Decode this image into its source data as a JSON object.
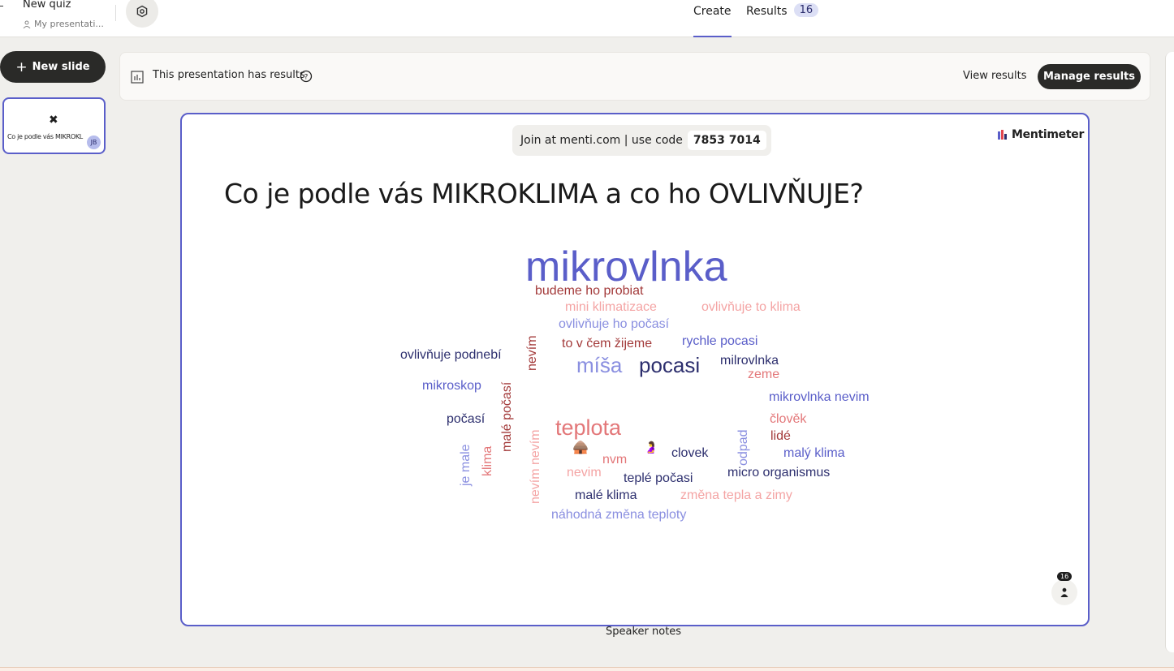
{
  "header": {
    "quiz_title": "New quiz",
    "folder": "My presentati...",
    "tabs": {
      "create": "Create",
      "results": "Results",
      "results_count": "16"
    }
  },
  "sidebar": {
    "new_slide_label": "New slide",
    "thumbnail": {
      "title": "Co je podle vás MIKROKL",
      "avatar": "JB",
      "icon": "✖"
    }
  },
  "results_bar": {
    "message": "This presentation has results",
    "view_results": "View results",
    "manage_results": "Manage results"
  },
  "slide": {
    "join_text": "Join at menti.com | use code",
    "join_code": "7853 7014",
    "brand": "Mentimeter",
    "question": "Co je podle vás MIKROKLIMA a co ho OVLIVŇUJE?",
    "participants": "16"
  },
  "chart_data": {
    "type": "wordcloud",
    "words": [
      {
        "text": "mikrovlnka",
        "weight": 5,
        "color": "#5a5ec9"
      },
      {
        "text": "teplota",
        "weight": 3,
        "color": "#e37779"
      },
      {
        "text": "míša",
        "weight": 3,
        "color": "#8a8fe0"
      },
      {
        "text": "pocasi",
        "weight": 3,
        "color": "#2d2f6e"
      },
      {
        "text": "budeme ho probiat",
        "weight": 1,
        "color": "#a33a3a"
      },
      {
        "text": "mini klimatizace",
        "weight": 1,
        "color": "#f4a4a4"
      },
      {
        "text": "ovlivňuje to klima",
        "weight": 1,
        "color": "#f4a4a4"
      },
      {
        "text": "ovlivňuje ho počasí",
        "weight": 1,
        "color": "#8a8fe0"
      },
      {
        "text": "to v čem žijeme",
        "weight": 1,
        "color": "#a33a3a"
      },
      {
        "text": "rychle pocasi",
        "weight": 1,
        "color": "#5a5ec9"
      },
      {
        "text": "ovlivňuje podnebí",
        "weight": 1,
        "color": "#2d2f6e"
      },
      {
        "text": "milrovlnka",
        "weight": 1,
        "color": "#2d2f6e"
      },
      {
        "text": "zeme",
        "weight": 1,
        "color": "#e37779"
      },
      {
        "text": "mikroskop",
        "weight": 1,
        "color": "#5a5ec9"
      },
      {
        "text": "mikrovlnka nevim",
        "weight": 1,
        "color": "#5a5ec9"
      },
      {
        "text": "počasí",
        "weight": 1,
        "color": "#2d2f6e"
      },
      {
        "text": "člověk",
        "weight": 1,
        "color": "#e37779"
      },
      {
        "text": "lidé",
        "weight": 1,
        "color": "#a33a3a"
      },
      {
        "text": "clovek",
        "weight": 1,
        "color": "#2d2f6e"
      },
      {
        "text": "malý klima",
        "weight": 1,
        "color": "#5a5ec9"
      },
      {
        "text": "nvm",
        "weight": 1,
        "color": "#e37779"
      },
      {
        "text": "nevim",
        "weight": 1,
        "color": "#f4a4a4"
      },
      {
        "text": "teplé počasi",
        "weight": 1,
        "color": "#2d2f6e"
      },
      {
        "text": "micro organismus",
        "weight": 1,
        "color": "#2d2f6e"
      },
      {
        "text": "malé klima",
        "weight": 1,
        "color": "#2d2f6e"
      },
      {
        "text": "změna tepla a zimy",
        "weight": 1,
        "color": "#f4a4a4"
      },
      {
        "text": "náhodná změna teploty",
        "weight": 1,
        "color": "#8a8fe0"
      },
      {
        "text": "nevím",
        "weight": 1,
        "color": "#a33a3a"
      },
      {
        "text": "malé počasí",
        "weight": 1,
        "color": "#a33a3a"
      },
      {
        "text": "nevím nevím",
        "weight": 1,
        "color": "#f4a4a4"
      },
      {
        "text": "je male",
        "weight": 1,
        "color": "#8a8fe0"
      },
      {
        "text": "klima",
        "weight": 1,
        "color": "#e37779"
      },
      {
        "text": "odpad",
        "weight": 1,
        "color": "#8a8fe0"
      },
      {
        "text": "🛖",
        "weight": 1,
        "color": "#a0522d"
      },
      {
        "text": "🤰",
        "weight": 1,
        "color": "#e0a030"
      }
    ]
  },
  "speaker_notes_label": "Speaker notes"
}
